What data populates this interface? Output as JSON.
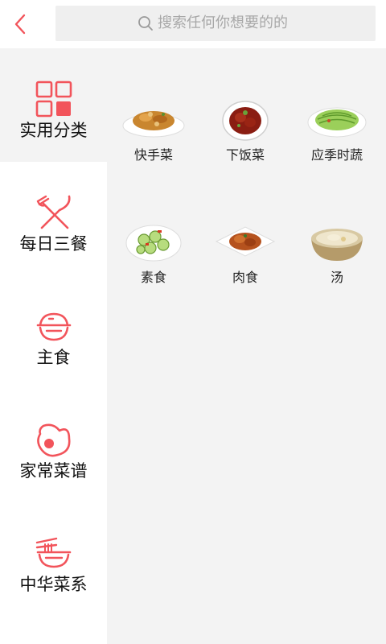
{
  "header": {
    "back_icon": "back-arrow-icon",
    "search_placeholder": "搜索任何你想要的的",
    "accent_color": "#f2545b"
  },
  "sidebar": {
    "items": [
      {
        "label": "实用分类",
        "icon": "grid-icon",
        "active": true
      },
      {
        "label": "每日三餐",
        "icon": "fork-knife-icon",
        "active": false
      },
      {
        "label": "主食",
        "icon": "rice-bowl-icon",
        "active": false
      },
      {
        "label": "家常菜谱",
        "icon": "fried-egg-icon",
        "active": false
      },
      {
        "label": "中华菜系",
        "icon": "noodle-bowl-icon",
        "active": false
      }
    ]
  },
  "content": {
    "items": [
      {
        "label": "快手菜",
        "image": "quick-dish-image"
      },
      {
        "label": "下饭菜",
        "image": "rice-dish-image"
      },
      {
        "label": "应季时蔬",
        "image": "seasonal-vegetable-image"
      },
      {
        "label": "素食",
        "image": "vegetarian-dish-image"
      },
      {
        "label": "肉食",
        "image": "meat-dish-image"
      },
      {
        "label": "汤",
        "image": "soup-image"
      }
    ]
  }
}
